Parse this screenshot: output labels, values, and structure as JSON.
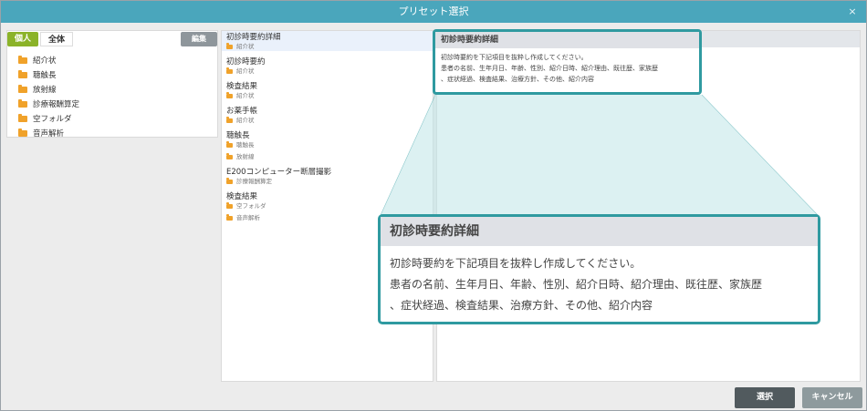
{
  "window": {
    "title": "プリセット選択",
    "close_symbol": "×"
  },
  "left_panel": {
    "tabs": [
      {
        "label": "個人",
        "active": true
      },
      {
        "label": "全体",
        "active": false
      }
    ],
    "edit_label": "編集",
    "tree": [
      {
        "label": "紹介状"
      },
      {
        "label": "聴触長"
      },
      {
        "label": "放射線"
      },
      {
        "label": "診療報酬算定"
      },
      {
        "label": "空フォルダ"
      },
      {
        "label": "音声解析"
      }
    ]
  },
  "middle_panel": {
    "items": [
      {
        "title": "初診時要約詳細",
        "folder": "紹介状",
        "selected": true
      },
      {
        "title": "初診時要約",
        "folder": "紹介状",
        "selected": false
      },
      {
        "title": "検査結果",
        "folder": "紹介状",
        "selected": false
      },
      {
        "title": "お薬手帳",
        "folder": "紹介状",
        "selected": false
      },
      {
        "title": "聴触長",
        "folders": [
          "聴触長",
          "放射線"
        ],
        "selected": false
      },
      {
        "title": "E200コンピューター断層撮影",
        "folder": "診療報酬算定",
        "selected": false
      },
      {
        "title": "検査結果",
        "folders": [
          "空フォルダ",
          "音声解析"
        ],
        "selected": false
      }
    ]
  },
  "preview": {
    "title": "初診時要約詳細",
    "line1": "初診時要約を下記項目を抜粋し作成してください。",
    "line2": "患者の名前、生年月日、年齢、性別、紹介日時、紹介理由、既往歴、家族歴",
    "line3": "、症状経過、検査結果、治療方針、その他、紹介内容"
  },
  "footer": {
    "select_label": "選択",
    "cancel_label": "キャンセル"
  },
  "colors": {
    "titlebar": "#4aa6bc",
    "accent": "#2f9aa0",
    "tab_active": "#8bb329"
  }
}
